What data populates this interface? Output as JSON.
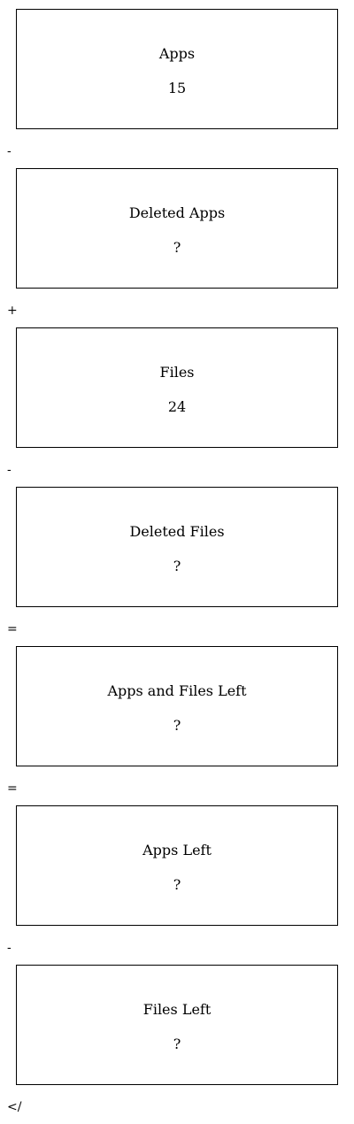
{
  "boxes": [
    {
      "title": "Apps",
      "value": "15"
    },
    {
      "title": "Deleted Apps",
      "value": "?"
    },
    {
      "title": "Files",
      "value": "24"
    },
    {
      "title": "Deleted Files",
      "value": "?"
    },
    {
      "title": "Apps and Files Left",
      "value": "?"
    },
    {
      "title": "Apps Left",
      "value": "?"
    },
    {
      "title": "Files Left",
      "value": "?"
    }
  ],
  "operators": [
    "-",
    "+",
    "-",
    "=",
    "=",
    "-",
    "</"
  ]
}
